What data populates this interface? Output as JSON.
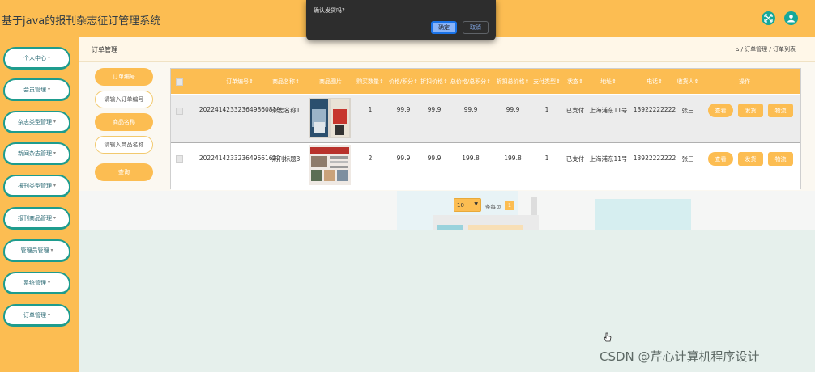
{
  "app": {
    "title": "基于java的报刊杂志征订管理系统"
  },
  "topbar": {
    "icons": [
      "expand-icon",
      "user-avatar-icon"
    ],
    "accent": "#16a89a",
    "brand": "#fcbd52"
  },
  "sidebar": {
    "items": [
      {
        "label": "个人中心"
      },
      {
        "label": "会员管理"
      },
      {
        "label": "杂志类型管理"
      },
      {
        "label": "新闻杂志管理"
      },
      {
        "label": "报刊类型管理"
      },
      {
        "label": "报刊商品管理"
      },
      {
        "label": "管理员管理"
      },
      {
        "label": "系统管理"
      },
      {
        "label": "订单管理"
      }
    ]
  },
  "page": {
    "title": "订单管理",
    "breadcrumb": [
      "订单管理",
      "订单列表"
    ],
    "breadcrumb_sep": " / "
  },
  "search": {
    "order_no_label": "订单编号",
    "order_no_placeholder": "请输入订单编号",
    "product_label": "商品名称",
    "product_placeholder": "请输入商品名称",
    "query_button": "查询"
  },
  "table": {
    "columns": [
      "订单编号",
      "商品名称",
      "商品图片",
      "购买数量",
      "价格/积分",
      "折扣价格",
      "总价格/总积分",
      "折扣总价格",
      "支付类型",
      "状态",
      "地址",
      "电话",
      "收货人",
      "操作"
    ],
    "rows": [
      {
        "order_no": "20224142332364986081​9",
        "product": "杂志名称1",
        "image": "magazine-cover",
        "qty": "1",
        "price": "99.9",
        "discount_price": "99.9",
        "total": "99.9",
        "discount_total": "99.9",
        "pay_type": "1",
        "status": "已支付",
        "address": "上海浦东11号",
        "phone": "13922222222",
        "receiver": "张三",
        "actions": [
          "查看",
          "发货",
          "物流"
        ]
      },
      {
        "order_no": "2022414233236496616​22",
        "product": "期刊标题3",
        "image": "journal-cover",
        "qty": "2",
        "price": "99.9",
        "discount_price": "99.9",
        "total": "199.8",
        "discount_total": "199.8",
        "pay_type": "1",
        "status": "已支付",
        "address": "上海浦东11号",
        "phone": "13922222222",
        "receiver": "张三",
        "actions": [
          "查看",
          "发货",
          "物流"
        ]
      }
    ]
  },
  "pager": {
    "page_size": "10",
    "label": "条每页",
    "current": "1"
  },
  "dialog": {
    "message": "确认发货吗?",
    "ok": "确定",
    "cancel": "取消"
  },
  "watermark": "CSDN @芹心计算机程序设计"
}
